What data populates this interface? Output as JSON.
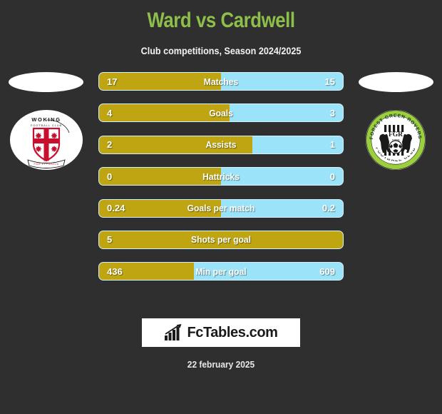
{
  "header": {
    "title": "Ward vs Cardwell",
    "subtitle": "Club competitions, Season 2024/2025",
    "title_color": "#8dbf4a"
  },
  "colors": {
    "background": "#2f2f2f",
    "home_bar": "#bfa511",
    "away_bar": "#9be3f8",
    "title_green": "#8dbf4a",
    "text_white": "#ffffff"
  },
  "teams": {
    "home": {
      "badge_name": "woking-fc-badge",
      "badge_label": "WOKING FOOTBALL CLUB"
    },
    "away": {
      "badge_name": "forest-green-rovers-badge",
      "badge_label": "FOREST GREEN ROVERS FOOTBALL CLUB"
    }
  },
  "chart_data": {
    "type": "bar",
    "title": "Ward vs Cardwell",
    "subtitle": "Club competitions, Season 2024/2025",
    "categories": [
      "Matches",
      "Goals",
      "Assists",
      "Hattricks",
      "Goals per match",
      "Shots per goal",
      "Min per goal"
    ],
    "series": [
      {
        "name": "Ward",
        "values": [
          "17",
          "4",
          "2",
          "0",
          "0.24",
          "5",
          "436"
        ]
      },
      {
        "name": "Cardwell",
        "values": [
          "15",
          "3",
          "1",
          "0",
          "0.2",
          "",
          "609"
        ]
      }
    ],
    "home_share_pct": [
      50,
      53.5,
      63,
      50,
      50,
      100,
      39
    ],
    "legend": "none",
    "grid": false
  },
  "rows": [
    {
      "label": "Matches",
      "home": "17",
      "away": "15",
      "home_pct": 50
    },
    {
      "label": "Goals",
      "home": "4",
      "away": "3",
      "home_pct": 53.5
    },
    {
      "label": "Assists",
      "home": "2",
      "away": "1",
      "home_pct": 63
    },
    {
      "label": "Hattricks",
      "home": "0",
      "away": "0",
      "home_pct": 50
    },
    {
      "label": "Goals per match",
      "home": "0.24",
      "away": "0.2",
      "home_pct": 50
    },
    {
      "label": "Shots per goal",
      "home": "5",
      "away": "",
      "home_pct": 100
    },
    {
      "label": "Min per goal",
      "home": "436",
      "away": "609",
      "home_pct": 39
    }
  ],
  "footer": {
    "logo_text": "FcTables.com",
    "logo_icon": "bar-chart-icon",
    "date": "22 february 2025"
  }
}
